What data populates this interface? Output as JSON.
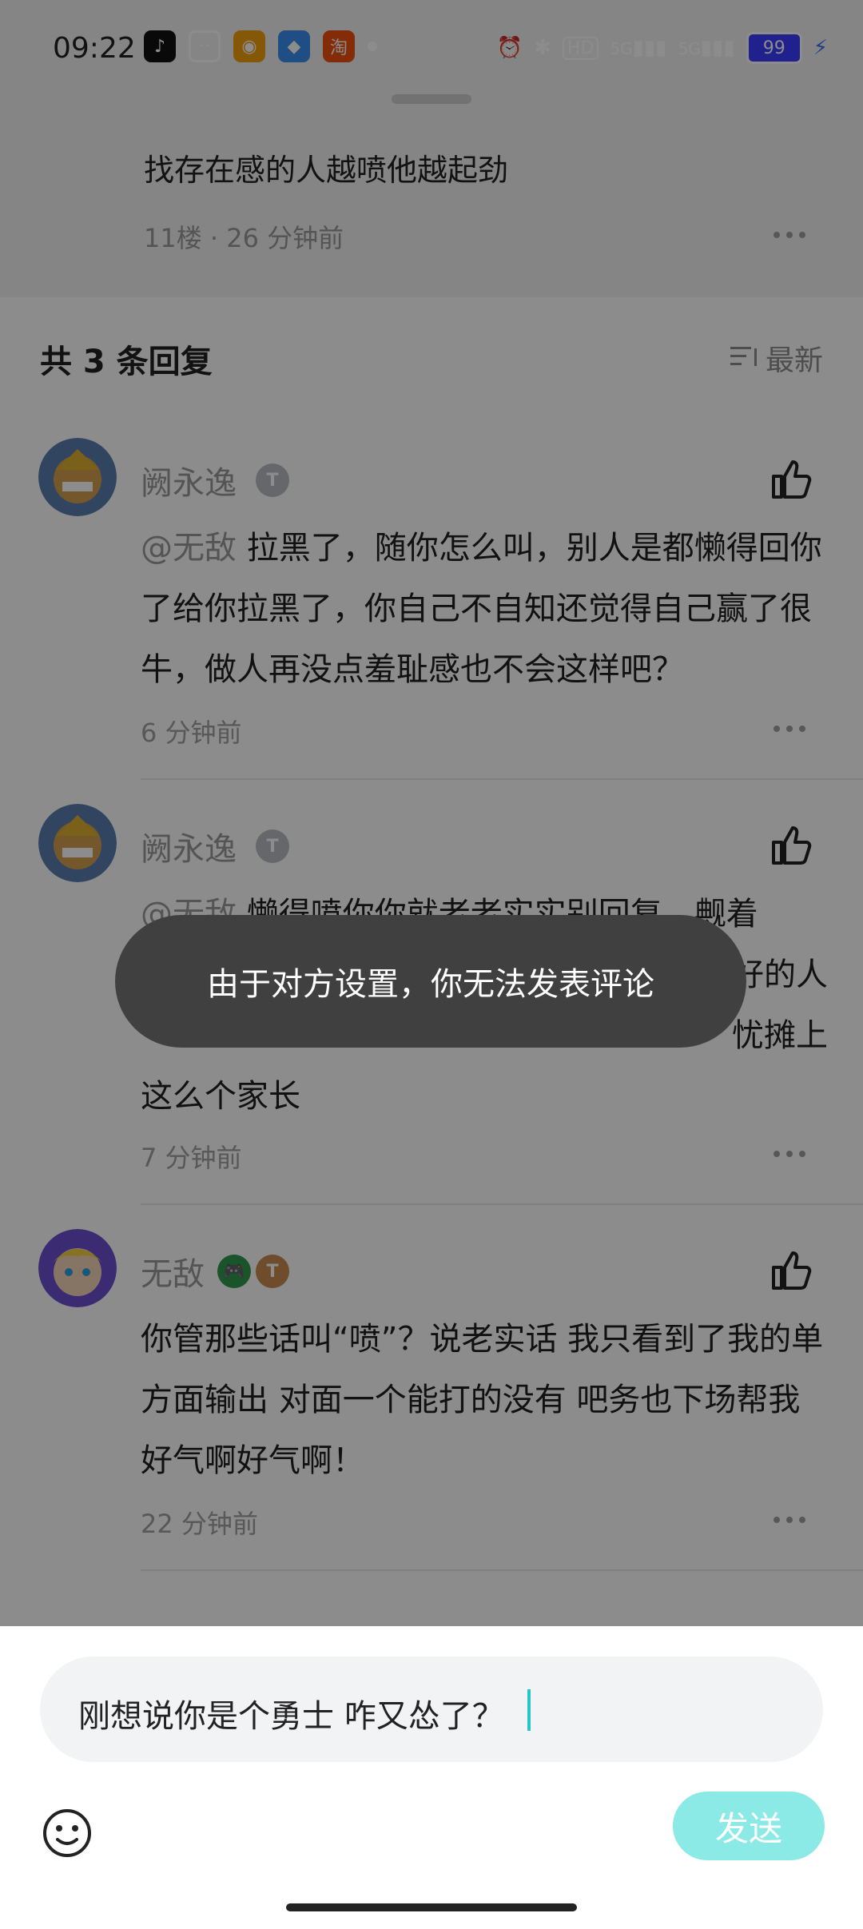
{
  "status_bar": {
    "time": "09:22",
    "battery": "99",
    "hd_label": "HD",
    "net_label_1": "5G",
    "net_label_2": "5G",
    "apps": [
      "tiktok-icon",
      "bilibili-icon",
      "weibo-icon",
      "blue-app-icon",
      "taobao-icon"
    ]
  },
  "parent_comment": {
    "text": "找存在感的人越喷他越起劲",
    "meta": "11楼 · 26 分钟前"
  },
  "replies_header": {
    "title": "共 3 条回复",
    "sort_label": "最新"
  },
  "replies": [
    {
      "username": "阙永逸",
      "badge": "T",
      "mention": "@无敌",
      "text": "拉黑了，随你怎么叫，别人是都懒得回你了给你拉黑了，你自己不自知还觉得自己赢了很牛，做人再没点羞耻感也不会这样吧？",
      "time": "6 分钟前"
    },
    {
      "username": "阙永逸",
      "badge": "T",
      "mention": "@无敌",
      "text": "懒得喷你你就老老实实别回复，觍着",
      "text_line2_tail": "好的人",
      "text_line3_tail": "忧摊上",
      "text_line4": "这么个家长",
      "time": "7 分钟前"
    },
    {
      "username": "无敌",
      "badge": "T",
      "text": "你管那些话叫“喷”？说老实话 我只看到了我的单方面输出 对面一个能打的没有 吧务也下场帮我 好气啊好气啊！",
      "time": "22 分钟前"
    }
  ],
  "toast": {
    "message": "由于对方设置，你无法发表评论"
  },
  "composer": {
    "value": "刚想说你是个勇士 咋又怂了？",
    "send_label": "发送"
  },
  "colors": {
    "accent": "#8ceae6",
    "caret": "#27c5c5",
    "toast_bg": "#404040"
  }
}
